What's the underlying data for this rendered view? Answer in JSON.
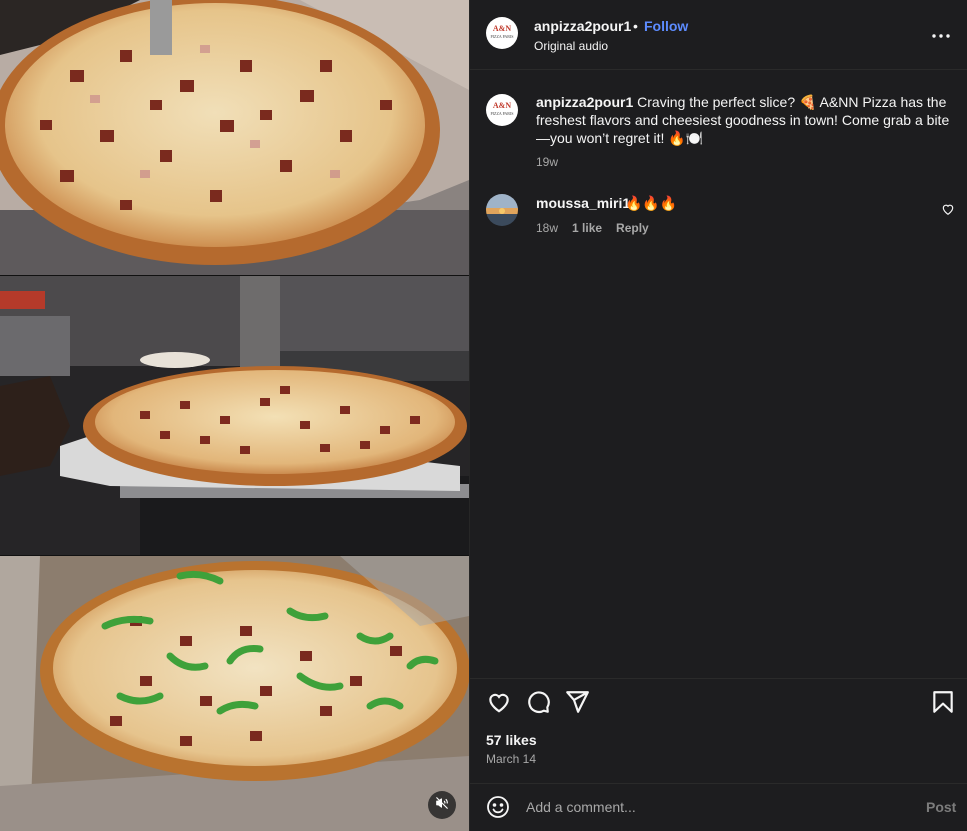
{
  "post": {
    "author": "anpizza2pour1",
    "separator": "•",
    "follow_label": "Follow",
    "audio_label": "Original audio",
    "avatar_logo": {
      "line1": "A&N",
      "line2": "PIZZA PARIS"
    },
    "caption": {
      "username": "anpizza2pour1",
      "text": "Craving the perfect slice? 🍕 A&NN Pizza has the freshest flavors and cheesiest goodness in town! Come grab a bite—you won’t regret it! 🔥🍽️",
      "time": "19w"
    },
    "likes": "57 likes",
    "date": "March 14"
  },
  "comments": [
    {
      "username": "moussa_miri1",
      "text": "🔥🔥🔥",
      "time": "18w",
      "likes": "1 like",
      "reply_label": "Reply"
    }
  ],
  "composer": {
    "placeholder": "Add a comment...",
    "post_label": "Post"
  },
  "icons": {
    "more": "more-horizontal-icon",
    "like": "heart-icon",
    "comment": "comment-bubble-icon",
    "share": "paper-plane-icon",
    "save": "bookmark-icon",
    "emoji": "smiley-icon",
    "mute": "speaker-muted-icon"
  },
  "colors": {
    "background": "#1d1d1f",
    "follow": "#5d8cff",
    "muted_text": "#a8a8a8",
    "post_disabled": "#7c7c7c"
  }
}
